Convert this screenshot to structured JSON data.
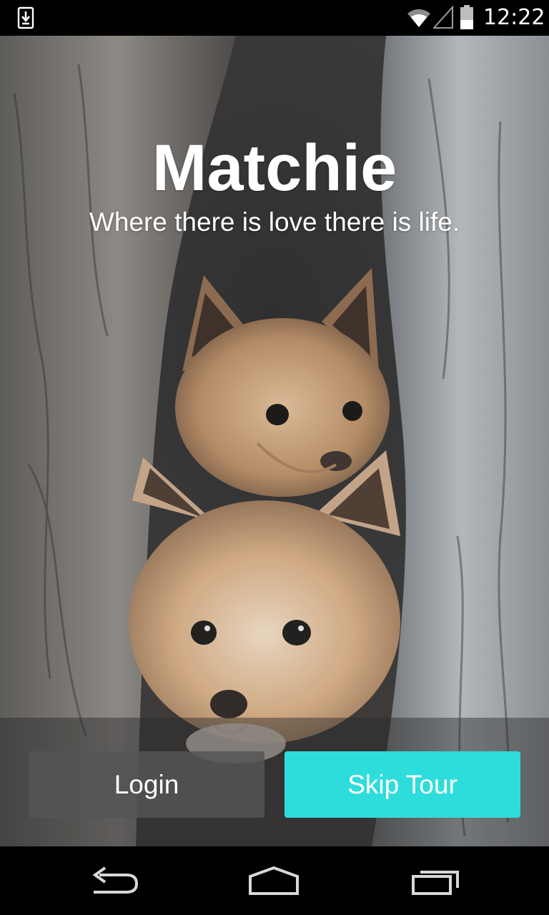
{
  "status_bar": {
    "time": "12:22",
    "icons": [
      "download-icon",
      "wifi-icon",
      "signal-icon",
      "battery-icon"
    ]
  },
  "app": {
    "title": "Matchie",
    "tagline": "Where there is love there is life."
  },
  "background": {
    "subject": "fox-kits-in-tree-hollow"
  },
  "actions": {
    "login_label": "Login",
    "skip_label": "Skip Tour"
  },
  "colors": {
    "accent": "#2fdcdc",
    "login_button": "#555555",
    "status_bar": "#000000",
    "nav_bar": "#000000"
  },
  "nav_bar": {
    "icons": [
      "back-icon",
      "home-icon",
      "recent-apps-icon"
    ]
  }
}
